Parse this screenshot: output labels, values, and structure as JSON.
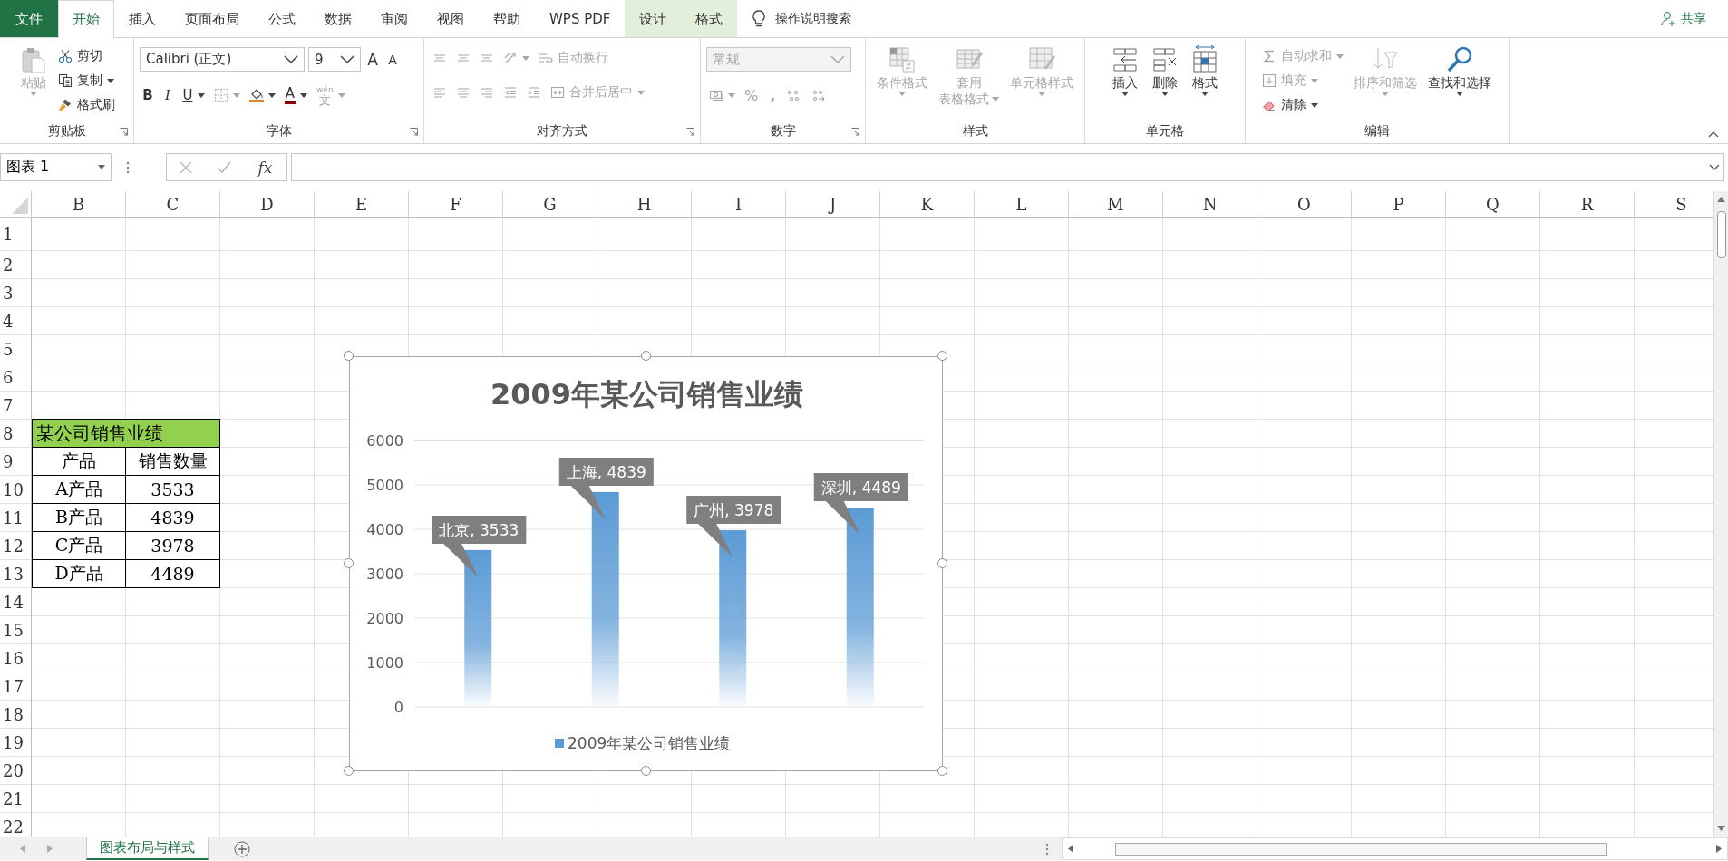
{
  "ribbon_tabs": [
    {
      "label": "文件",
      "kind": "file",
      "selected": false
    },
    {
      "label": "开始",
      "kind": "normal",
      "selected": true
    },
    {
      "label": "插入",
      "kind": "normal",
      "selected": false
    },
    {
      "label": "页面布局",
      "kind": "normal",
      "selected": false
    },
    {
      "label": "公式",
      "kind": "normal",
      "selected": false
    },
    {
      "label": "数据",
      "kind": "normal",
      "selected": false
    },
    {
      "label": "审阅",
      "kind": "normal",
      "selected": false
    },
    {
      "label": "视图",
      "kind": "normal",
      "selected": false
    },
    {
      "label": "帮助",
      "kind": "normal",
      "selected": false
    },
    {
      "label": "WPS PDF",
      "kind": "normal",
      "selected": false
    },
    {
      "label": "设计",
      "kind": "contextual",
      "selected": false
    },
    {
      "label": "格式",
      "kind": "contextual",
      "selected": false
    }
  ],
  "tell_me": {
    "label": "操作说明搜索"
  },
  "share": {
    "label": "共享"
  },
  "ribbon_groups": [
    {
      "label": "剪贴板",
      "launcher": true,
      "stacks": [
        {
          "items": [
            {
              "kind": "paste",
              "label": "粘贴",
              "disabled": true,
              "dropdown": true
            }
          ]
        },
        {
          "items": [
            {
              "kind": "cut",
              "label": "剪切",
              "disabled": false,
              "dropdown": false
            },
            {
              "kind": "copy",
              "label": "复制",
              "disabled": false,
              "dropdown": true
            },
            {
              "kind": "format-painter",
              "label": "格式刷",
              "disabled": false,
              "dropdown": false
            }
          ]
        }
      ]
    },
    {
      "label": "字体",
      "launcher": true,
      "lines": [
        {
          "items": [
            {
              "kind": "font-name",
              "value": "Calibri (正文)",
              "disabled": false
            },
            {
              "kind": "font-size",
              "value": "9",
              "disabled": false
            },
            {
              "kind": "grow-font",
              "label": "A",
              "disabled": false,
              "dropdown": false
            },
            {
              "kind": "shrink-font",
              "label": "A",
              "disabled": false,
              "dropdown": false
            }
          ]
        },
        {
          "items": [
            {
              "kind": "bold",
              "label": "B",
              "disabled": false,
              "dropdown": false
            },
            {
              "kind": "italic",
              "label": "I",
              "disabled": false,
              "dropdown": false
            },
            {
              "kind": "underline",
              "label": "U",
              "disabled": false,
              "dropdown": true
            },
            {
              "kind": "borders",
              "disabled": true,
              "dropdown": true
            },
            {
              "kind": "fill-color",
              "disabled": false,
              "dropdown": true
            },
            {
              "kind": "font-color",
              "label": "A",
              "disabled": false,
              "dropdown": true
            },
            {
              "kind": "phonetic",
              "label": "文",
              "ruby": "wén",
              "disabled": true,
              "dropdown": true
            }
          ]
        }
      ]
    },
    {
      "label": "对齐方式",
      "launcher": true,
      "lines": [
        {
          "items": [
            {
              "kind": "align-top",
              "disabled": true,
              "dropdown": false
            },
            {
              "kind": "align-middle",
              "disabled": true,
              "dropdown": false
            },
            {
              "kind": "align-bottom",
              "disabled": true,
              "dropdown": false
            },
            {
              "kind": "orientation",
              "disabled": true,
              "dropdown": true
            },
            {
              "kind": "wrap-text",
              "label": "自动换行",
              "disabled": true,
              "dropdown": false
            }
          ]
        },
        {
          "items": [
            {
              "kind": "align-left",
              "disabled": true,
              "dropdown": false
            },
            {
              "kind": "align-center",
              "disabled": true,
              "dropdown": false
            },
            {
              "kind": "align-right",
              "disabled": true,
              "dropdown": false
            },
            {
              "kind": "decrease-indent",
              "disabled": true,
              "dropdown": false
            },
            {
              "kind": "increase-indent",
              "disabled": true,
              "dropdown": false
            },
            {
              "kind": "merge",
              "label": "合并后居中",
              "disabled": true,
              "dropdown": true
            }
          ]
        }
      ]
    },
    {
      "label": "数字",
      "launcher": true,
      "lines": [
        {
          "items": [
            {
              "kind": "number-format",
              "value": "常规",
              "disabled": true
            }
          ]
        },
        {
          "items": [
            {
              "kind": "currency",
              "disabled": true,
              "dropdown": true
            },
            {
              "kind": "percent",
              "label": "%",
              "disabled": true,
              "dropdown": false
            },
            {
              "kind": "comma",
              "label": ",",
              "disabled": true,
              "dropdown": false
            },
            {
              "kind": "increase-decimal",
              "disabled": true,
              "dropdown": false
            },
            {
              "kind": "decrease-decimal",
              "disabled": true,
              "dropdown": false
            }
          ]
        }
      ]
    },
    {
      "label": "样式",
      "launcher": false,
      "stacks": [
        {
          "items": [
            {
              "kind": "conditional-format",
              "label": "条件格式",
              "disabled": true,
              "dropdown": true
            }
          ]
        },
        {
          "items": [
            {
              "kind": "table-style",
              "label_lines": [
                "套用",
                "表格格式"
              ],
              "disabled": true,
              "dropdown": true
            }
          ]
        },
        {
          "items": [
            {
              "kind": "cell-style",
              "label": "单元格样式",
              "disabled": true,
              "dropdown": true
            }
          ]
        }
      ]
    },
    {
      "label": "单元格",
      "launcher": false,
      "stacks": [
        {
          "items": [
            {
              "kind": "insert",
              "label": "插入",
              "disabled": false,
              "dropdown": true
            }
          ]
        },
        {
          "items": [
            {
              "kind": "delete",
              "label": "删除",
              "disabled": false,
              "dropdown": true
            }
          ]
        },
        {
          "items": [
            {
              "kind": "format",
              "label": "格式",
              "disabled": false,
              "dropdown": true
            }
          ]
        }
      ]
    },
    {
      "label": "编辑",
      "launcher": false,
      "stacks": [
        {
          "items": [
            {
              "kind": "sum",
              "label": "自动求和",
              "disabled": true,
              "dropdown": true
            },
            {
              "kind": "fill",
              "label": "填充",
              "disabled": true,
              "dropdown": true
            },
            {
              "kind": "clear",
              "label": "清除",
              "disabled": false,
              "dropdown": true
            }
          ]
        },
        {
          "items": [
            {
              "kind": "sort-filter",
              "label": "排序和筛选",
              "disabled": true,
              "dropdown": true
            }
          ]
        },
        {
          "items": [
            {
              "kind": "find-select",
              "label": "查找和选择",
              "disabled": false,
              "dropdown": true
            }
          ]
        }
      ]
    }
  ],
  "formula_bar": {
    "name_box": "图表 1",
    "insert_function": "fx"
  },
  "sheet": {
    "columns": [
      "B",
      "C",
      "D",
      "E",
      "F",
      "G",
      "H",
      "I",
      "J",
      "K",
      "L",
      "M",
      "N",
      "O",
      "P",
      "Q",
      "R",
      "S"
    ],
    "rows": [
      "1",
      "2",
      "3",
      "4",
      "5",
      "6",
      "7",
      "8",
      "9",
      "10",
      "11",
      "12",
      "13",
      "14",
      "15",
      "16",
      "17",
      "18",
      "19",
      "20",
      "21",
      "22"
    ],
    "table": {
      "title": "某公司销售业绩",
      "header": [
        "产品",
        "销售数量"
      ],
      "rows": [
        [
          "A产品",
          "3533"
        ],
        [
          "B产品",
          "4839"
        ],
        [
          "C产品",
          "3978"
        ],
        [
          "D产品",
          "4489"
        ]
      ]
    },
    "chart": {
      "chart_data": {
        "type": "bar",
        "title": "2009年某公司销售业绩",
        "grid": true,
        "series": [
          {
            "name": "2009年某公司销售业绩",
            "color": "#5b9bd5",
            "values": [
              3533,
              4839,
              3978,
              4489
            ]
          }
        ],
        "ylim": [
          0,
          6000
        ],
        "yticks": [
          0,
          1000,
          2000,
          3000,
          4000,
          5000,
          6000
        ],
        "value_labels": [
          "北京, 3533",
          "上海, 4839",
          "广州, 3978",
          "深圳, 4489"
        ]
      }
    }
  },
  "sheet_tabs": [
    {
      "label": "图表布局与样式",
      "selected": true
    }
  ]
}
